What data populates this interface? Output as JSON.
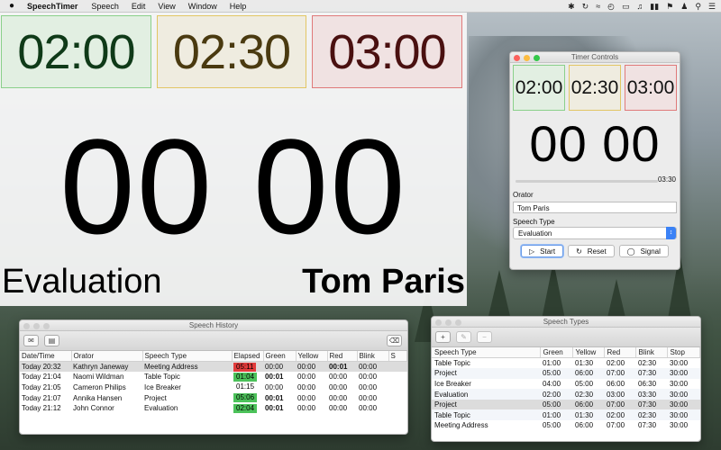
{
  "menubar": {
    "app_name": "SpeechTimer",
    "items": [
      "Speech",
      "Edit",
      "View",
      "Window",
      "Help"
    ]
  },
  "display": {
    "lights": [
      {
        "label": "02:00",
        "color": "green"
      },
      {
        "label": "02:30",
        "color": "yellow"
      },
      {
        "label": "03:00",
        "color": "red"
      }
    ],
    "time": "00 00",
    "speech_type": "Evaluation",
    "orator": "Tom Paris"
  },
  "controls": {
    "title": "Timer Controls",
    "lights": [
      {
        "label": "02:00",
        "color": "green"
      },
      {
        "label": "02:30",
        "color": "yellow"
      },
      {
        "label": "03:00",
        "color": "red"
      }
    ],
    "time": "00 00",
    "progress_fraction": 0.0,
    "remaining": "03:30",
    "orator_label": "Orator",
    "orator_value": "Tom Paris",
    "type_label": "Speech Type",
    "type_value": "Evaluation",
    "start_label": "Start",
    "reset_label": "Reset",
    "signal_label": "Signal"
  },
  "history": {
    "title": "Speech History",
    "columns": [
      "Date/Time",
      "Orator",
      "Speech Type",
      "Elapsed",
      "Green",
      "Yellow",
      "Red",
      "Blink",
      "S"
    ],
    "rows": [
      {
        "datetime": "Today 20:32",
        "orator": "Kathryn Janeway",
        "type": "Meeting Address",
        "elapsed": "05:11",
        "elapsed_status": "red",
        "green": "00:00",
        "yellow": "00:00",
        "red": "00:01",
        "blink": "00:00",
        "selected": true,
        "bold_col": "red"
      },
      {
        "datetime": "Today 21:04",
        "orator": "Naomi Wildman",
        "type": "Table Topic",
        "elapsed": "01:04",
        "elapsed_status": "green",
        "green": "00:01",
        "yellow": "00:00",
        "red": "00:00",
        "blink": "00:00",
        "selected": false,
        "bold_col": "green"
      },
      {
        "datetime": "Today 21:05",
        "orator": "Cameron Philips",
        "type": "Ice Breaker",
        "elapsed": "01:15",
        "elapsed_status": "none",
        "green": "00:00",
        "yellow": "00:00",
        "red": "00:00",
        "blink": "00:00",
        "selected": false,
        "bold_col": ""
      },
      {
        "datetime": "Today 21:07",
        "orator": "Annika Hansen",
        "type": "Project",
        "elapsed": "05:06",
        "elapsed_status": "green",
        "green": "00:01",
        "yellow": "00:00",
        "red": "00:00",
        "blink": "00:00",
        "selected": false,
        "bold_col": "green"
      },
      {
        "datetime": "Today 21:12",
        "orator": "John Connor",
        "type": "Evaluation",
        "elapsed": "02:04",
        "elapsed_status": "green",
        "green": "00:01",
        "yellow": "00:00",
        "red": "00:00",
        "blink": "00:00",
        "selected": false,
        "bold_col": "green"
      }
    ]
  },
  "types": {
    "title": "Speech Types",
    "columns": [
      "Speech Type",
      "Green",
      "Yellow",
      "Red",
      "Blink",
      "Stop"
    ],
    "rows": [
      {
        "name": "Table Topic",
        "green": "01:00",
        "yellow": "01:30",
        "red": "02:00",
        "blink": "02:30",
        "stop": "30:00",
        "selected": false
      },
      {
        "name": "Project",
        "green": "05:00",
        "yellow": "06:00",
        "red": "07:00",
        "blink": "07:30",
        "stop": "30:00",
        "selected": false
      },
      {
        "name": "Ice Breaker",
        "green": "04:00",
        "yellow": "05:00",
        "red": "06:00",
        "blink": "06:30",
        "stop": "30:00",
        "selected": false
      },
      {
        "name": "Evaluation",
        "green": "02:00",
        "yellow": "02:30",
        "red": "03:00",
        "blink": "03:30",
        "stop": "30:00",
        "selected": false
      },
      {
        "name": "Project",
        "green": "05:00",
        "yellow": "06:00",
        "red": "07:00",
        "blink": "07:30",
        "stop": "30:00",
        "selected": true
      },
      {
        "name": "Table Topic",
        "green": "01:00",
        "yellow": "01:30",
        "red": "02:00",
        "blink": "02:30",
        "stop": "30:00",
        "selected": false
      },
      {
        "name": "Meeting Address",
        "green": "05:00",
        "yellow": "06:00",
        "red": "07:00",
        "blink": "07:30",
        "stop": "30:00",
        "selected": false
      }
    ]
  },
  "colors": {
    "green_light": "#e2efe2",
    "yellow_light": "#efece0",
    "red_light": "#f0e2e2",
    "elapsed_red": "#e23c3c",
    "elapsed_green": "#4cc25a"
  }
}
